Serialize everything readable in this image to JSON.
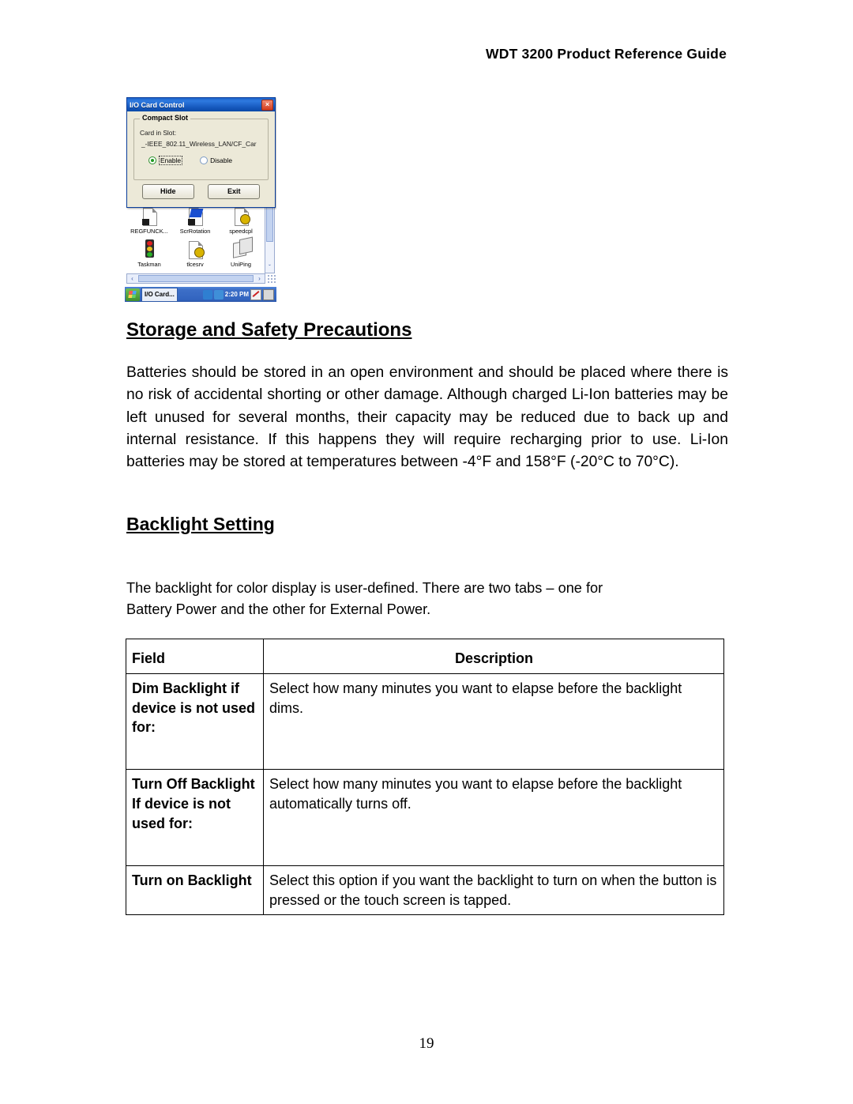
{
  "header": {
    "title": "WDT 3200 Product Reference Guide"
  },
  "device_screenshot": {
    "dialog": {
      "title": "I/O Card Control",
      "close_label": "×",
      "group_legend": "Compact Slot",
      "card_in_slot_label": "Card in Slot:",
      "card_in_slot_value": "_-IEEE_802.11_Wireless_LAN/CF_Car",
      "radio_enable": "Enable",
      "radio_disable": "Disable",
      "selected_radio": "Enable",
      "button_hide": "Hide",
      "button_exit": "Exit"
    },
    "desktop_icons": [
      {
        "label": "REGFUNCK...",
        "icon": "application-file-icon"
      },
      {
        "label": "ScrRotation",
        "icon": "screen-rotation-icon"
      },
      {
        "label": "speedcpl",
        "icon": "speed-control-panel-icon"
      },
      {
        "label": "Taskman",
        "icon": "traffic-light-icon"
      },
      {
        "label": "tlcesrv",
        "icon": "document-gear-icon"
      },
      {
        "label": "UniPing",
        "icon": "stacked-sheets-icon"
      }
    ],
    "taskbar": {
      "start_label": "start-icon",
      "task_button": "I/O Card...",
      "clock": "2:20 PM",
      "tray_icons": [
        "network-icon",
        "network-activity-icon",
        "stylus-icon",
        "printer-icon"
      ]
    },
    "scrollbars": {
      "h_left_arrow": "‹",
      "h_right_arrow": "›",
      "v_down_arrow": "ˇ"
    }
  },
  "sections": {
    "storage": {
      "heading": "Storage and Safety Precautions",
      "body": "Batteries should be stored in an open environment and should be placed where there is no risk of accidental shorting or other damage.   Although charged Li-Ion batteries may be left unused for several months, their capacity may be reduced due to back up and internal resistance. If this happens they will require recharging prior to use.   Li-Ion batteries may be stored at temperatures between -4°F and 158°F (-20°C to 70°C)."
    },
    "backlight": {
      "heading": "Backlight Setting",
      "body": "The backlight for color display is user-defined. There are two tabs – one for Battery Power and the other for External Power."
    }
  },
  "table": {
    "headers": {
      "field": "Field",
      "description": "Description"
    },
    "rows": [
      {
        "field": "Dim Backlight if device is not used for:",
        "description": "Select how many minutes you want to elapse before the backlight dims."
      },
      {
        "field": "Turn Off Backlight If device is not used for:",
        "description": "Select how many minutes you want to elapse before the backlight automatically turns off."
      },
      {
        "field": "Turn on Backlight",
        "description": "Select this option if you want the backlight to turn on when the button is pressed or the touch screen is tapped."
      }
    ]
  },
  "footer": {
    "page_number": "19"
  }
}
